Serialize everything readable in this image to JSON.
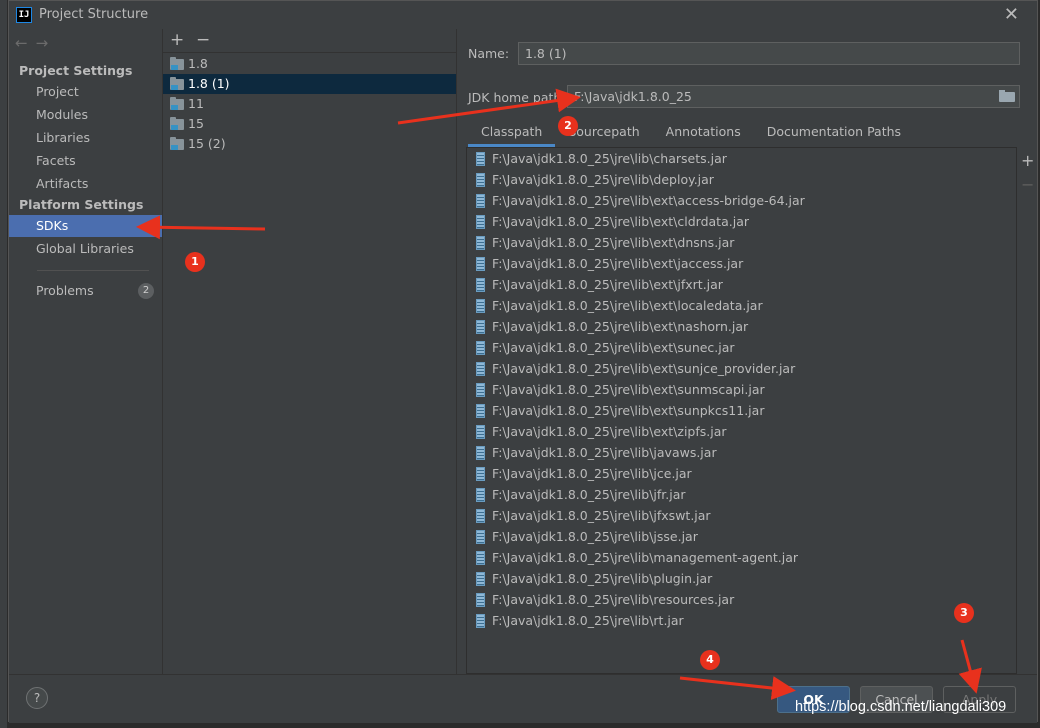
{
  "window": {
    "title": "Project Structure"
  },
  "nav": {
    "project_settings_header": "Project Settings",
    "platform_settings_header": "Platform Settings",
    "items": {
      "project": "Project",
      "modules": "Modules",
      "libraries": "Libraries",
      "facets": "Facets",
      "artifacts": "Artifacts",
      "sdks": "SDKs",
      "global_libraries": "Global Libraries",
      "problems": "Problems"
    },
    "problems_count": "2",
    "selected": "SDKs"
  },
  "sdk_list": {
    "items": [
      "1.8",
      "1.8 (1)",
      "11",
      "15",
      "15 (2)"
    ],
    "selected": "1.8 (1)"
  },
  "details": {
    "name_label": "Name:",
    "name_value": "1.8 (1)",
    "jdk_home_label": "JDK home path:",
    "jdk_home_value": "F:\\Java\\jdk1.8.0_25",
    "tabs": [
      "Classpath",
      "Sourcepath",
      "Annotations",
      "Documentation Paths"
    ],
    "active_tab": "Classpath",
    "classpath": [
      "F:\\Java\\jdk1.8.0_25\\jre\\lib\\charsets.jar",
      "F:\\Java\\jdk1.8.0_25\\jre\\lib\\deploy.jar",
      "F:\\Java\\jdk1.8.0_25\\jre\\lib\\ext\\access-bridge-64.jar",
      "F:\\Java\\jdk1.8.0_25\\jre\\lib\\ext\\cldrdata.jar",
      "F:\\Java\\jdk1.8.0_25\\jre\\lib\\ext\\dnsns.jar",
      "F:\\Java\\jdk1.8.0_25\\jre\\lib\\ext\\jaccess.jar",
      "F:\\Java\\jdk1.8.0_25\\jre\\lib\\ext\\jfxrt.jar",
      "F:\\Java\\jdk1.8.0_25\\jre\\lib\\ext\\localedata.jar",
      "F:\\Java\\jdk1.8.0_25\\jre\\lib\\ext\\nashorn.jar",
      "F:\\Java\\jdk1.8.0_25\\jre\\lib\\ext\\sunec.jar",
      "F:\\Java\\jdk1.8.0_25\\jre\\lib\\ext\\sunjce_provider.jar",
      "F:\\Java\\jdk1.8.0_25\\jre\\lib\\ext\\sunmscapi.jar",
      "F:\\Java\\jdk1.8.0_25\\jre\\lib\\ext\\sunpkcs11.jar",
      "F:\\Java\\jdk1.8.0_25\\jre\\lib\\ext\\zipfs.jar",
      "F:\\Java\\jdk1.8.0_25\\jre\\lib\\javaws.jar",
      "F:\\Java\\jdk1.8.0_25\\jre\\lib\\jce.jar",
      "F:\\Java\\jdk1.8.0_25\\jre\\lib\\jfr.jar",
      "F:\\Java\\jdk1.8.0_25\\jre\\lib\\jfxswt.jar",
      "F:\\Java\\jdk1.8.0_25\\jre\\lib\\jsse.jar",
      "F:\\Java\\jdk1.8.0_25\\jre\\lib\\management-agent.jar",
      "F:\\Java\\jdk1.8.0_25\\jre\\lib\\plugin.jar",
      "F:\\Java\\jdk1.8.0_25\\jre\\lib\\resources.jar",
      "F:\\Java\\jdk1.8.0_25\\jre\\lib\\rt.jar"
    ]
  },
  "buttons": {
    "help": "?",
    "ok": "OK",
    "cancel": "Cancel",
    "apply": "Apply"
  },
  "annotations": [
    "1",
    "2",
    "3",
    "4"
  ],
  "watermark": "https://blog.csdn.net/liangdali309",
  "colors": {
    "accent": "#4b6eaf",
    "annotation_red": "#e8311d",
    "primary_button": "#365880"
  }
}
